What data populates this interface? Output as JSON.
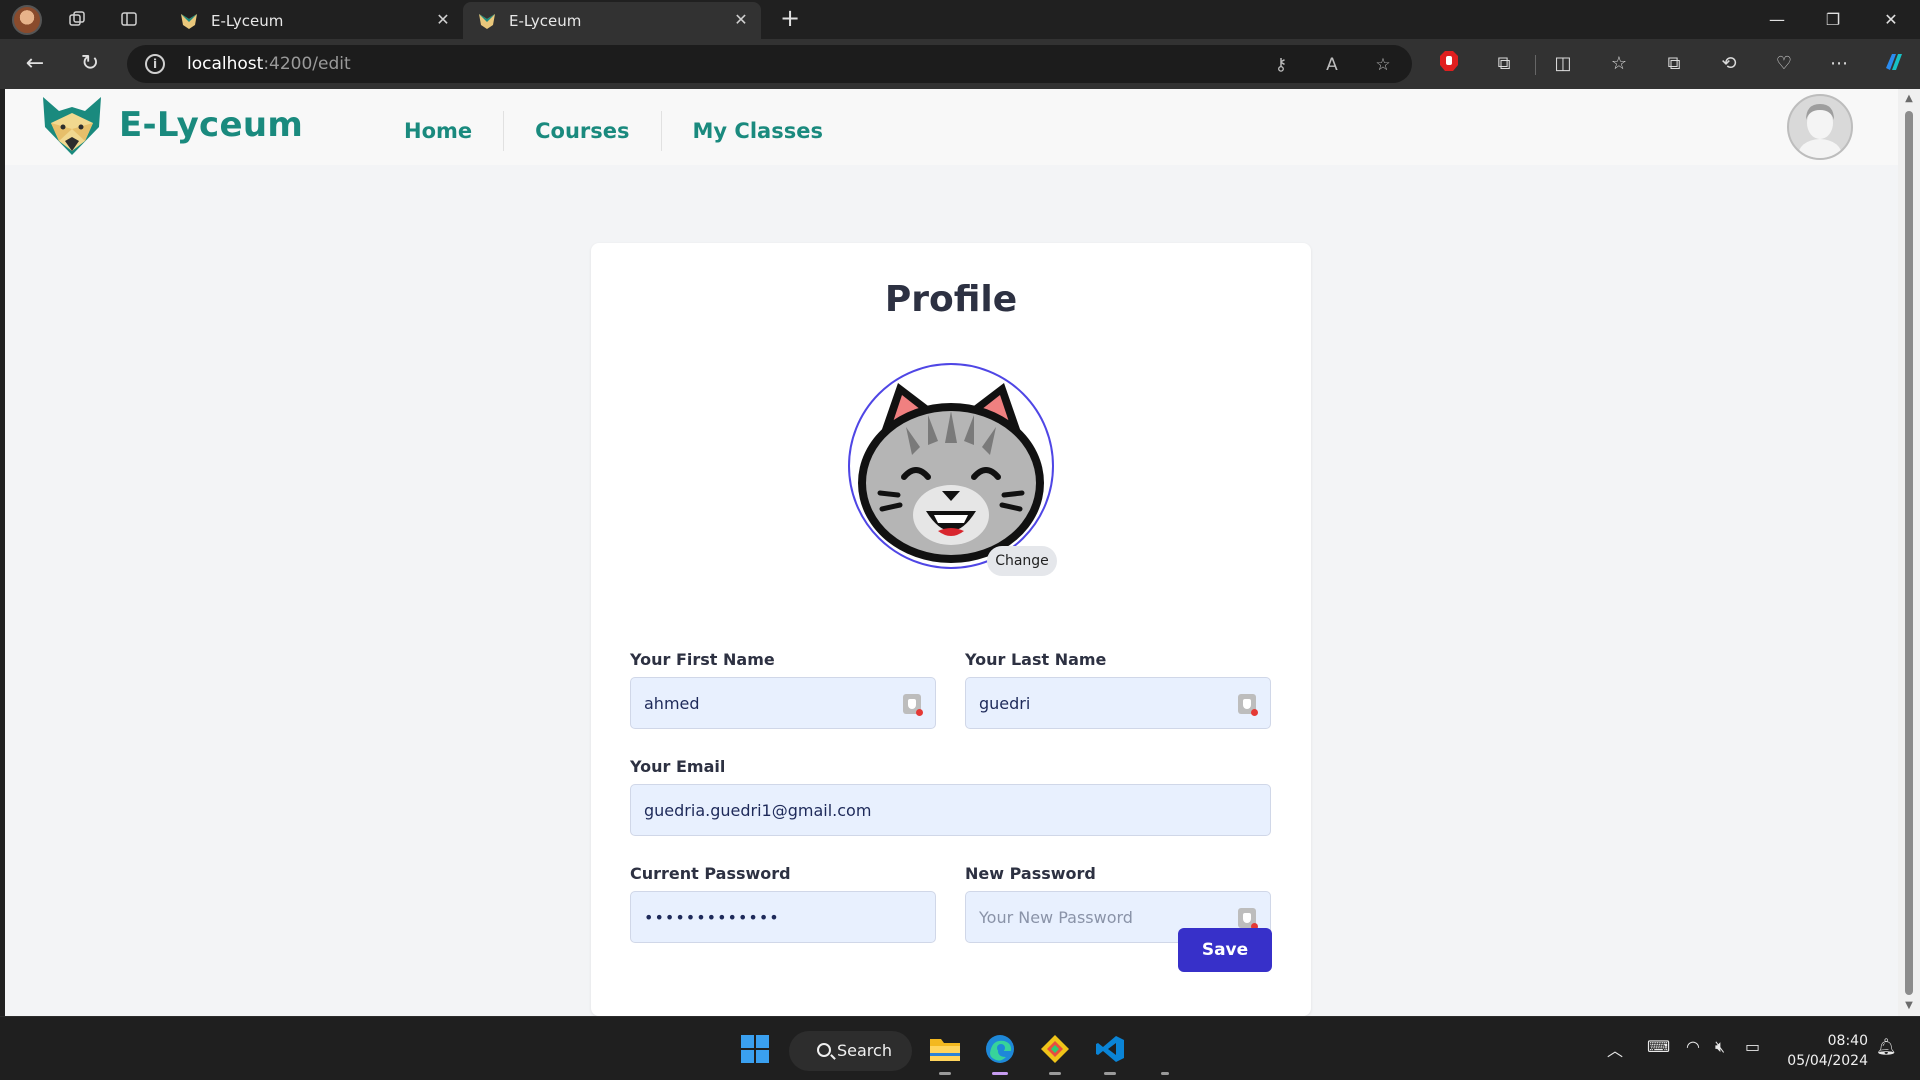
{
  "browser": {
    "tabs": [
      {
        "title": "E-Lyceum",
        "active": false
      },
      {
        "title": "E-Lyceum",
        "active": true
      }
    ],
    "url_host": "localhost",
    "url_path": ":4200/edit"
  },
  "site": {
    "brand": "E-Lyceum",
    "nav": [
      {
        "label": "Home"
      },
      {
        "label": "Courses"
      },
      {
        "label": "My Classes"
      }
    ],
    "brand_color": "#1a8a7e"
  },
  "profile": {
    "title": "Profile",
    "change_label": "Change",
    "first_name_label": "Your First Name",
    "first_name_value": "ahmed",
    "last_name_label": "Your Last Name",
    "last_name_value": "guedri",
    "email_label": "Your Email",
    "email_value": "guedria.guedri1@gmail.com",
    "current_password_label": "Current Password",
    "current_password_value": "•••••••••••••",
    "new_password_label": "New Password",
    "new_password_placeholder": "Your New Password",
    "save_label": "Save",
    "accent_color": "#3730c9"
  },
  "taskbar": {
    "search_label": "Search",
    "time": "08:40",
    "date": "05/04/2024"
  }
}
